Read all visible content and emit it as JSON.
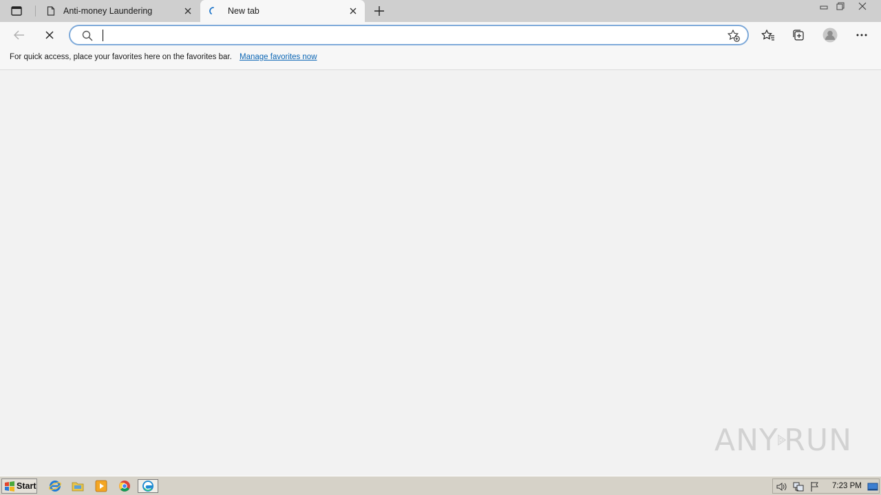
{
  "tabs": [
    {
      "label": "Anti-money Laundering",
      "active": false
    },
    {
      "label": "New tab",
      "active": true
    }
  ],
  "address": {
    "value": "",
    "placeholder": ""
  },
  "favorites_bar": {
    "message": "For quick access, place your favorites here on the favorites bar.",
    "link": "Manage favorites now"
  },
  "watermark": {
    "left": "ANY",
    "right": "RUN"
  },
  "taskbar": {
    "start_label": "Start",
    "apps": [
      "internet-explorer",
      "file-explorer",
      "media-player",
      "chrome",
      "edge"
    ],
    "clock": "7:23 PM"
  },
  "colors": {
    "tabstrip": "#cfcfcf",
    "toolbar": "#f7f7f7",
    "content": "#f2f2f2",
    "address_border": "#7da9d9",
    "link": "#0a65b4",
    "taskbar": "#d6d2c8"
  }
}
